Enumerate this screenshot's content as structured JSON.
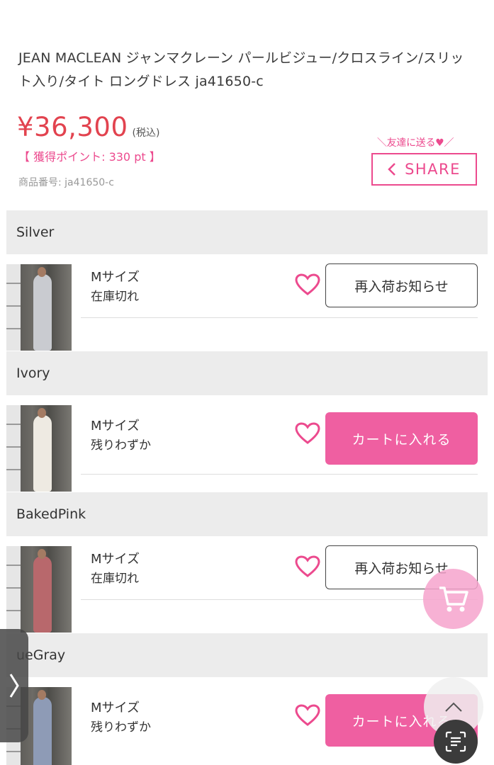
{
  "product": {
    "title": "JEAN MACLEAN ジャンマクレーン パールビジュー/クロスライン/スリット入り/タイト ロングドレス ja41650-c",
    "price": "¥36,300",
    "tax_label": "(税込)",
    "points": "【 獲得ポイント: 330 pt 】",
    "sku": "商品番号: ja41650-c"
  },
  "share": {
    "caption": "＼友達に送る♥／",
    "label": "SHARE"
  },
  "variants": [
    {
      "color": "Silver",
      "size": "Mサイズ",
      "stock": "在庫切れ",
      "action": "再入荷お知らせ",
      "action_type": "restock",
      "dress_color": "#c9cbd0"
    },
    {
      "color": "Ivory",
      "size": "Mサイズ",
      "stock": "残りわずか",
      "action": "カートに入れる",
      "action_type": "cart",
      "dress_color": "#eeeae2"
    },
    {
      "color": "BakedPink",
      "size": "Mサイズ",
      "stock": "在庫切れ",
      "action": "再入荷お知らせ",
      "action_type": "restock",
      "dress_color": "#b8686c"
    },
    {
      "color": "ueGray",
      "size": "Mサイズ",
      "stock": "残りわずか",
      "action": "カートに入れる",
      "action_type": "cart",
      "dress_color": "#8e9bb6"
    }
  ],
  "icons": {
    "share": "chevron-left-icon",
    "favorite": "heart-outline-icon",
    "cart_fab": "cart-icon",
    "top_fab": "chevron-up-icon",
    "scan_fab": "scan-text-icon",
    "side_tab": "chevron-right-icon"
  },
  "colors": {
    "accent_pink": "#ef5fa1",
    "price_red": "#e2434f",
    "points_pink": "#ec4a8e"
  }
}
